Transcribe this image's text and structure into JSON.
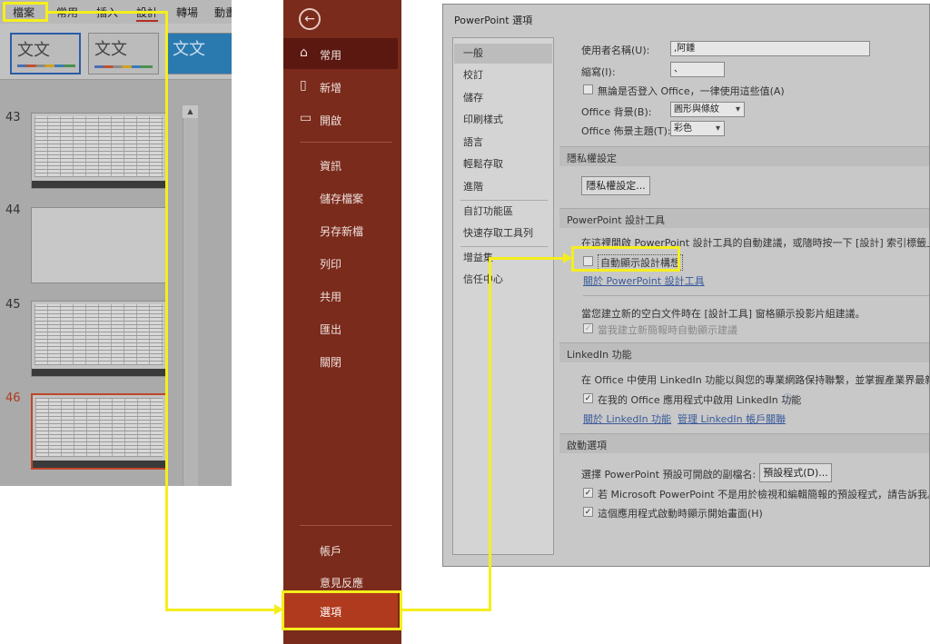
{
  "ribbon": {
    "tabs": [
      "檔案",
      "常用",
      "插入",
      "設計",
      "轉場",
      "動畫"
    ],
    "themes": [
      "文文",
      "文文",
      "文文"
    ]
  },
  "slides": {
    "scroll_up": "▲",
    "items": [
      {
        "number": "43",
        "kind": "spreadsheet"
      },
      {
        "number": "44",
        "kind": "blank"
      },
      {
        "number": "45",
        "kind": "spreadsheet"
      },
      {
        "number": "46",
        "kind": "spreadsheet",
        "selected": true
      }
    ]
  },
  "backstage": {
    "back_icon": "←",
    "items": {
      "home": "常用",
      "new": "新增",
      "open": "開啟",
      "info": "資訊",
      "save_as_file": "儲存檔案",
      "save_as_new": "另存新檔",
      "print": "列印",
      "share": "共用",
      "export": "匯出",
      "close": "關閉",
      "account": "帳戶",
      "feedback": "意見反應",
      "options": "選項"
    }
  },
  "dialog": {
    "title": "PowerPoint 選項",
    "categories": [
      "一般",
      "校訂",
      "儲存",
      "印刷樣式",
      "語言",
      "輕鬆存取",
      "進階",
      "自訂功能區",
      "快速存取工具列",
      "增益集",
      "信任中心"
    ],
    "user_name_label": "使用者名稱(U):",
    "user_name_value": ",阿鍾",
    "initials_label": "縮寫(I):",
    "initials_value": "、",
    "always_use_values": "無論是否登入 Office，一律使用這些值(A)",
    "office_background_label": "Office 背景(B):",
    "office_background_value": "圓形與條紋",
    "office_theme_label": "Office 佈景主題(T):",
    "office_theme_value": "彩色",
    "privacy_section": "隱私權設定",
    "privacy_button": "隱私權設定...",
    "designer_section": "PowerPoint 設計工具",
    "designer_desc": "在這裡開啟 PowerPoint 設計工具的自動建議，或隨時按一下 [設計] 索引標籤上的",
    "auto_show_design_ideas": "自動顯示設計構想",
    "about_designer_link": "關於 PowerPoint 設計工具",
    "new_blank_desc": "當您建立新的空白文件時在 [設計工具] 窗格顯示投影片組建議。",
    "new_blank_checkbox": "當我建立新簡報時自動顯示建議",
    "linkedin_section": "LinkedIn 功能",
    "linkedin_desc": "在 Office 中使用 LinkedIn 功能以與您的專業網路保持聯繫，並掌握產業界最新動態",
    "linkedin_checkbox": "在我的 Office 應用程式中啟用 LinkedIn 功能",
    "linkedin_info_icon": "ⓘ",
    "about_linkedin_link": "關於 LinkedIn 功能",
    "manage_linkedin_link": "管理 LinkedIn 帳戶關聯",
    "startup_section": "啟動選項",
    "default_ext_label": "選擇 PowerPoint 預設可開啟的副檔名:",
    "default_programs_button": "預設程式(D)...",
    "not_default_checkbox": "若 Microsoft PowerPoint 不是用於檢視和編輯簡報的預設程式，請告訴我。(",
    "show_start_screen_checkbox": "這個應用程式啟動時顯示開始畫面(H)"
  },
  "colors": {
    "highlight": "#f5ee1c",
    "backstage_bg": "#7a2b1c",
    "options_selected": "#b03a1e"
  }
}
